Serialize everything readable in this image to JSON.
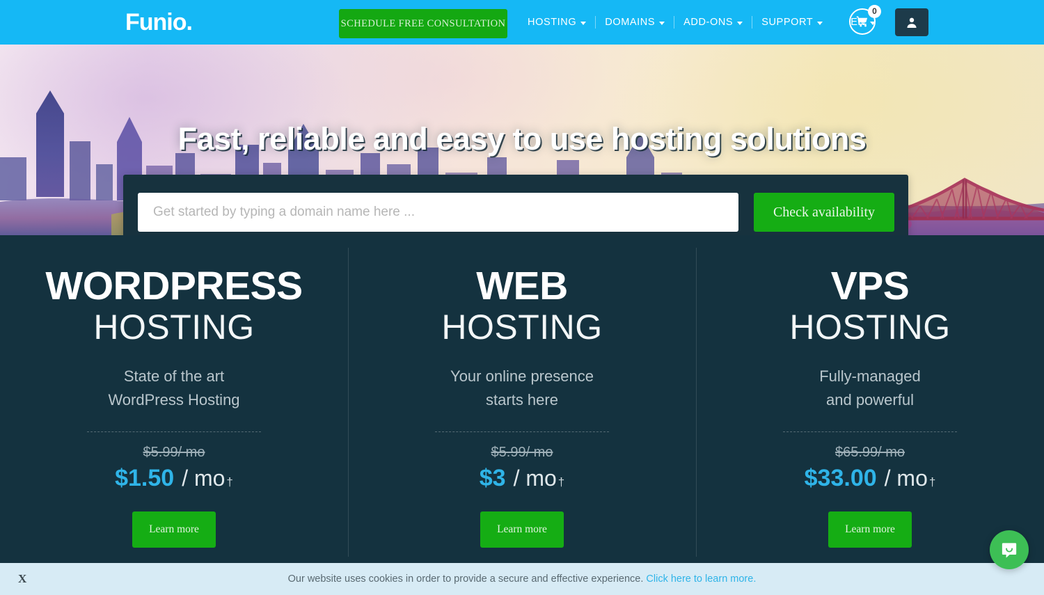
{
  "header": {
    "logo": "Funio.",
    "consultation_button": "SCHEDULE FREE CONSULTATION",
    "nav": [
      {
        "label": "HOSTING",
        "has_caret": true
      },
      {
        "label": "DOMAINS",
        "has_caret": true
      },
      {
        "label": "ADD-ONS",
        "has_caret": true
      },
      {
        "label": "SUPPORT",
        "has_caret": true
      }
    ],
    "language": "EN",
    "cart_count": "0",
    "cart_icon": "shopping-cart-icon",
    "user_icon": "user-account-icon",
    "bg_color": "#15b8f5",
    "button_color": "#14a812"
  },
  "hero": {
    "title": "Fast, reliable and easy to use hosting solutions",
    "search_placeholder": "Get started by typing a domain name here ...",
    "search_value": "",
    "check_button": "Check availability",
    "panel_color": "#17323e"
  },
  "pricing": {
    "section_bg": "#14323f",
    "accent_price_color": "#2fb4e8",
    "button_color": "#15ad14",
    "plans": [
      {
        "name": "WORDPRESS",
        "type": "HOSTING",
        "description_line1": "State of the art",
        "description_line2": "WordPress Hosting",
        "old_price": "$5.99/ mo",
        "new_price": "$1.50",
        "per_unit": "/ mo",
        "dagger": "†",
        "cta": "Learn more"
      },
      {
        "name": "WEB",
        "type": "HOSTING",
        "description_line1": "Your online presence",
        "description_line2": "starts here",
        "old_price": "$5.99/ mo",
        "new_price": "$3",
        "per_unit": "/ mo",
        "dagger": "†",
        "cta": "Learn more"
      },
      {
        "name": "VPS",
        "type": "HOSTING",
        "description_line1": "Fully-managed",
        "description_line2": "and powerful",
        "old_price": "$65.99/ mo",
        "new_price": "$33.00",
        "per_unit": "/ mo",
        "dagger": "†",
        "cta": "Learn more"
      }
    ]
  },
  "cookie_banner": {
    "close_label": "X",
    "message": "Our website uses cookies in order to provide a secure and effective experience.",
    "link": "Click here to learn more.",
    "bg_color": "#d7ebf5",
    "link_color": "#2fb4e8"
  },
  "chat": {
    "icon": "chat-bubble-icon",
    "color": "#3dbf55"
  }
}
